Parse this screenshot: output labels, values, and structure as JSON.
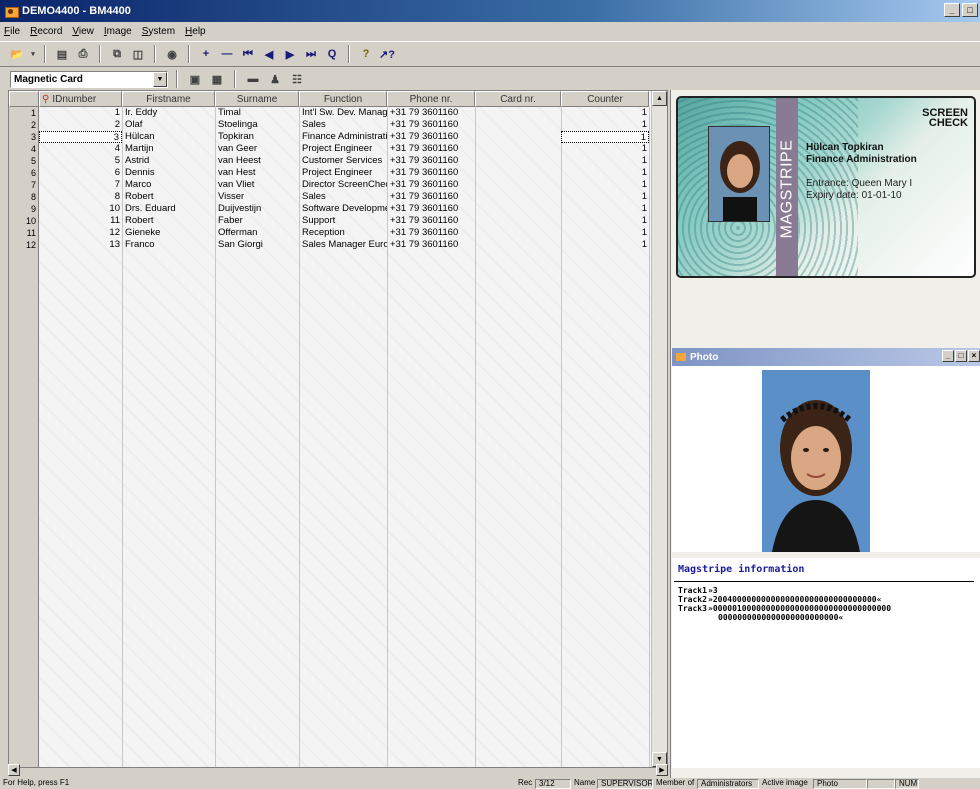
{
  "window": {
    "title": "DEMO4400 - BM4400",
    "minimize_glyph": "_",
    "maximize_glyph": "□"
  },
  "menu": [
    "File",
    "Record",
    "View",
    "Image",
    "System",
    "Help"
  ],
  "toolbar": {
    "icons": [
      "open-icon",
      "print-preview-icon",
      "print-icon",
      "copy-icon",
      "paste-icon",
      "camera-icon",
      "add-record-icon",
      "delete-record-icon",
      "first-record-icon",
      "prev-record-icon",
      "next-record-icon",
      "last-record-icon",
      "find-icon",
      "help-icon",
      "context-help-icon"
    ]
  },
  "layout_selector": {
    "selected": "Magnetic Card"
  },
  "grid": {
    "columns": [
      "IDnumber",
      "Firstname",
      "Surname",
      "Function",
      "Phone nr.",
      "Card nr.",
      "Counter"
    ],
    "selected_row": 3,
    "rows": [
      {
        "n": "1",
        "id": "1",
        "first": "Ir. Eddy",
        "sur": "Timal",
        "func": "Int'l Sw. Dev. Manager",
        "phone": "+31 79 3601160",
        "card": "",
        "counter": "1"
      },
      {
        "n": "2",
        "id": "2",
        "first": "Olaf",
        "sur": "Stoelinga",
        "func": "Sales",
        "phone": "+31 79 3601160",
        "card": "",
        "counter": "1"
      },
      {
        "n": "3",
        "id": "3",
        "first": "Hülcan",
        "sur": "Topkiran",
        "func": "Finance Administration",
        "phone": "+31 79 3601160",
        "card": "",
        "counter": "1"
      },
      {
        "n": "4",
        "id": "4",
        "first": "Martijn",
        "sur": "van Geer",
        "func": "Project Engineer",
        "phone": "+31 79 3601160",
        "card": "",
        "counter": "1"
      },
      {
        "n": "5",
        "id": "5",
        "first": "Astrid",
        "sur": "van Heest",
        "func": "Customer Services",
        "phone": "+31 79 3601160",
        "card": "",
        "counter": "1"
      },
      {
        "n": "6",
        "id": "6",
        "first": "Dennis",
        "sur": "van Hest",
        "func": "Project Engineer",
        "phone": "+31 79 3601160",
        "card": "",
        "counter": "1"
      },
      {
        "n": "7",
        "id": "7",
        "first": "Marco",
        "sur": "van Vliet",
        "func": "Director ScreenCheck",
        "phone": "+31 79 3601160",
        "card": "",
        "counter": "1"
      },
      {
        "n": "8",
        "id": "8",
        "first": "Robert",
        "sur": "Visser",
        "func": "Sales",
        "phone": "+31 79 3601160",
        "card": "",
        "counter": "1"
      },
      {
        "n": "9",
        "id": "10",
        "first": "Drs. Eduard",
        "sur": "Duijvestijn",
        "func": "Software Development",
        "phone": "+31 79 3601160",
        "card": "",
        "counter": "1"
      },
      {
        "n": "10",
        "id": "11",
        "first": "Robert",
        "sur": "Faber",
        "func": "Support",
        "phone": "+31 79 3601160",
        "card": "",
        "counter": "1"
      },
      {
        "n": "11",
        "id": "12",
        "first": "Gieneke",
        "sur": "Offerman",
        "func": "Reception",
        "phone": "+31 79 3601160",
        "card": "",
        "counter": "1"
      },
      {
        "n": "12",
        "id": "13",
        "first": "Franco",
        "sur": "San Giorgi",
        "func": "Sales Manager Europe",
        "phone": "+31 79 3601160",
        "card": "",
        "counter": "1"
      }
    ]
  },
  "card": {
    "logo_line1": "SCREEN",
    "logo_line2": "CHECK",
    "stripe_text": "MAGSTRIPE",
    "name": "Hülcan Topkiran",
    "department": "Finance Administration",
    "entrance": "Entrance: Queen Mary I",
    "expiry": "Expiry date:  01-01-10"
  },
  "photo_window": {
    "title": "Photo"
  },
  "magstripe": {
    "title": "Magstripe information",
    "tracks": [
      {
        "label": "Track1",
        "value": "»3"
      },
      {
        "label": "Track2",
        "value": "»2004000000000000000000000000000000«"
      },
      {
        "label": "Track3",
        "value": "»0000010000000000000000000000000000000"
      },
      {
        "label": "",
        "value": "0000000000000000000000000«"
      }
    ]
  },
  "status": {
    "help": "For Help, press F1",
    "rec_label": "Rec",
    "rec_value": "3/12",
    "name_label": "Name",
    "name_value": "SUPERVISOR",
    "member_label": "Member of",
    "member_value": "Administrators",
    "active_label": "Active image",
    "active_value": "Photo",
    "num": "NUM"
  }
}
